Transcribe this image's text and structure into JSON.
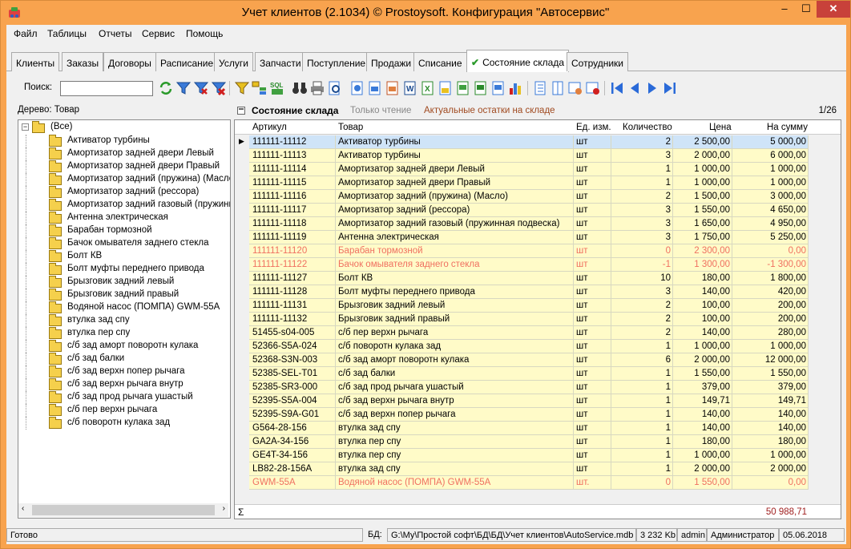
{
  "window": {
    "title": "Учет клиентов (2.1034) © Prostoysoft. Конфигурация \"Автосервис\"",
    "min": "–",
    "max": "☐",
    "close": "✕"
  },
  "menu": [
    "Файл",
    "Таблицы",
    "Отчеты",
    "Сервис",
    "Помощь"
  ],
  "tabs": [
    "Клиенты",
    "Заказы",
    "Договоры",
    "Расписание",
    "Услуги",
    "Запчасти",
    "Поступление",
    "Продажи",
    "Списание",
    "Состояние склада",
    "Сотрудники"
  ],
  "active_tab": "Состояние склада",
  "toolbar": {
    "search_label": "Поиск:",
    "search_value": ""
  },
  "tree": {
    "caption": "Дерево: Товар",
    "root": "(Все)",
    "items": [
      "Активатор турбины",
      "Амортизатор задней двери Левый",
      "Амортизатор задней двери Правый",
      "Амортизатор задний (пружина) (Масло)",
      "Амортизатор задний (рессора)",
      "Амортизатор задний газовый (пружинн",
      "Антенна электрическая",
      "Барабан тормозной",
      "Бачок омывателя заднего стекла",
      "Болт КВ",
      "Болт муфты переднего привода",
      "Брызговик задний левый",
      "Брызговик задний правый",
      "Водяной насос  (ПОМПА)  GWM-55A",
      "втулка зад спу",
      "втулка пер спу",
      "с/б зад аморт поворотн кулака",
      "с/б зад балки",
      "с/б зад верхн попер рычага",
      "с/б зад верхн рычага внутр",
      "с/б зад прод рычага ушастый",
      "с/б пер верхн рычага",
      "с/б поворотн кулака зад"
    ]
  },
  "grid": {
    "title": "Состояние склада",
    "mode": "Только чтение",
    "subtitle": "Актуальные остатки на складе",
    "page": "1/26",
    "columns": [
      "Артикул",
      "Товар",
      "Ед. изм.",
      "Количество",
      "Цена",
      "На сумму"
    ],
    "rows": [
      {
        "art": "111111-11112",
        "name": "Активатор турбины",
        "unit": "шт",
        "qty": "2",
        "price": "2 500,00",
        "sum": "5 000,00",
        "state": "selected"
      },
      {
        "art": "111111-11113",
        "name": "Активатор турбины",
        "unit": "шт",
        "qty": "3",
        "price": "2 000,00",
        "sum": "6 000,00",
        "state": "normal"
      },
      {
        "art": "111111-11114",
        "name": "Амортизатор задней двери Левый",
        "unit": "шт",
        "qty": "1",
        "price": "1 000,00",
        "sum": "1 000,00",
        "state": "normal"
      },
      {
        "art": "111111-11115",
        "name": "Амортизатор задней двери Правый",
        "unit": "шт",
        "qty": "1",
        "price": "1 000,00",
        "sum": "1 000,00",
        "state": "normal"
      },
      {
        "art": "111111-11116",
        "name": "Амортизатор задний (пружина) (Масло)",
        "unit": "шт",
        "qty": "2",
        "price": "1 500,00",
        "sum": "3 000,00",
        "state": "normal"
      },
      {
        "art": "111111-11117",
        "name": "Амортизатор задний (рессора)",
        "unit": "шт",
        "qty": "3",
        "price": "1 550,00",
        "sum": "4 650,00",
        "state": "normal"
      },
      {
        "art": "111111-11118",
        "name": "Амортизатор задний газовый (пружинная подвеска)",
        "unit": "шт",
        "qty": "3",
        "price": "1 650,00",
        "sum": "4 950,00",
        "state": "normal"
      },
      {
        "art": "111111-11119",
        "name": "Антенна электрическая",
        "unit": "шт",
        "qty": "3",
        "price": "1 750,00",
        "sum": "5 250,00",
        "state": "normal"
      },
      {
        "art": "111111-11120",
        "name": "Барабан тормозной",
        "unit": "шт",
        "qty": "0",
        "price": "2 300,00",
        "sum": "0,00",
        "state": "zero"
      },
      {
        "art": "111111-11122",
        "name": "Бачок омывателя заднего стекла",
        "unit": "шт",
        "qty": "-1",
        "price": "1 300,00",
        "sum": "-1 300,00",
        "state": "zero"
      },
      {
        "art": "111111-11127",
        "name": "Болт КВ",
        "unit": "шт",
        "qty": "10",
        "price": "180,00",
        "sum": "1 800,00",
        "state": "normal"
      },
      {
        "art": "111111-11128",
        "name": "Болт муфты переднего привода",
        "unit": "шт",
        "qty": "3",
        "price": "140,00",
        "sum": "420,00",
        "state": "normal"
      },
      {
        "art": "111111-11131",
        "name": "Брызговик задний левый",
        "unit": "шт",
        "qty": "2",
        "price": "100,00",
        "sum": "200,00",
        "state": "normal"
      },
      {
        "art": "111111-11132",
        "name": "Брызговик задний правый",
        "unit": "шт",
        "qty": "2",
        "price": "100,00",
        "sum": "200,00",
        "state": "normal"
      },
      {
        "art": "51455-s04-005",
        "name": "с/б пер верхн рычага",
        "unit": "шт",
        "qty": "2",
        "price": "140,00",
        "sum": "280,00",
        "state": "normal"
      },
      {
        "art": "52366-S5A-024",
        "name": "с/б поворотн кулака зад",
        "unit": "шт",
        "qty": "1",
        "price": "1 000,00",
        "sum": "1 000,00",
        "state": "normal"
      },
      {
        "art": "52368-S3N-003",
        "name": "с/б зад аморт поворотн кулака",
        "unit": "шт",
        "qty": "6",
        "price": "2 000,00",
        "sum": "12 000,00",
        "state": "normal"
      },
      {
        "art": "52385-SEL-T01",
        "name": "с/б зад балки",
        "unit": "шт",
        "qty": "1",
        "price": "1 550,00",
        "sum": "1 550,00",
        "state": "normal"
      },
      {
        "art": "52385-SR3-000",
        "name": "с/б зад прод рычага ушастый",
        "unit": "шт",
        "qty": "1",
        "price": "379,00",
        "sum": "379,00",
        "state": "normal"
      },
      {
        "art": "52395-S5A-004",
        "name": "с/б зад верхн рычага внутр",
        "unit": "шт",
        "qty": "1",
        "price": "149,71",
        "sum": "149,71",
        "state": "normal"
      },
      {
        "art": "52395-S9A-G01",
        "name": "с/б зад верхн попер рычага",
        "unit": "шт",
        "qty": "1",
        "price": "140,00",
        "sum": "140,00",
        "state": "normal"
      },
      {
        "art": "G564-28-156",
        "name": "втулка зад спу",
        "unit": "шт",
        "qty": "1",
        "price": "140,00",
        "sum": "140,00",
        "state": "normal"
      },
      {
        "art": "GA2A-34-156",
        "name": "втулка пер спу",
        "unit": "шт",
        "qty": "1",
        "price": "180,00",
        "sum": "180,00",
        "state": "normal"
      },
      {
        "art": "GE4T-34-156",
        "name": "втулка пер спу",
        "unit": "шт",
        "qty": "1",
        "price": "1 000,00",
        "sum": "1 000,00",
        "state": "normal"
      },
      {
        "art": "LB82-28-156A",
        "name": "втулка зад спу",
        "unit": "шт",
        "qty": "1",
        "price": "2 000,00",
        "sum": "2 000,00",
        "state": "normal"
      },
      {
        "art": "GWM-55A",
        "name": "Водяной насос  (ПОМПА)  GWM-55A",
        "unit": "шт.",
        "qty": "0",
        "price": "1 550,00",
        "sum": "0,00",
        "state": "zero"
      }
    ],
    "sum_symbol": "Σ",
    "total": "50 988,71"
  },
  "status": {
    "ready": "Готово",
    "db_label": "БД:",
    "db_path": "G:\\My\\Простой софт\\БД\\БД\\Учет клиентов\\AutoService.mdb",
    "size": "3 232 Kb",
    "user": "admin",
    "role": "Администратор",
    "date": "05.06.2018"
  },
  "colors": {
    "titlebar": "#f8a34e",
    "row_bg": "#fffbc8",
    "selected": "#cfe4f8",
    "zero_text": "#f07060",
    "subtitle": "#a04a20"
  }
}
